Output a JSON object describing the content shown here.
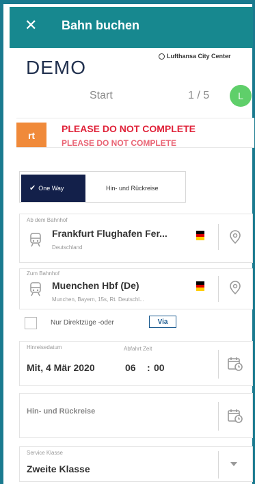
{
  "header": {
    "close_icon": "close-icon",
    "title": "Bahn buchen"
  },
  "brand": {
    "label": "Lufthansa City Center"
  },
  "demo_label": "DEMO",
  "progress": {
    "step_label": "Start",
    "step_count": "1 / 5",
    "avatar_initial": "L"
  },
  "warning": {
    "badge": "rt",
    "text": "PLEASE DO NOT COMPLETE",
    "ghost_text": "PLEASE DO NOT COMPLETE"
  },
  "trip_type": {
    "selected": "One Way",
    "other": "Hin- und Rückreise"
  },
  "from": {
    "label": "Ab dem Bahnhof",
    "station": "Frankfurt Flughafen Fer...",
    "country": "Deutschland",
    "flag_colors": [
      "#000000",
      "#dd0000",
      "#ffce00"
    ]
  },
  "to": {
    "label": "Zum Bahnhof",
    "station": "Muenchen Hbf (De)",
    "detail": "Munchen, Bayern, 15s, Rt. Deutschl...",
    "flag_colors": [
      "#000000",
      "#dd0000",
      "#ffce00"
    ]
  },
  "direct": {
    "label": "Nur Direktzüge -oder",
    "via_button": "Via"
  },
  "departure": {
    "date_label": "Hinreisedatum",
    "time_label": "Abfahrt Zeit",
    "date": "Mit, 4 Mär 2020",
    "hour": "06",
    "colon": ":",
    "minute": "00"
  },
  "return": {
    "label": "Hin- und Rückreise"
  },
  "service": {
    "label": "Service Klasse",
    "value": "Zweite Klasse"
  },
  "colors": {
    "app_bar": "#17888f",
    "frame": "#1a7a8f",
    "primary_dark": "#13204a",
    "alert": "#e0233a",
    "badge": "#f08a3a",
    "avatar": "#5fcf6a"
  }
}
